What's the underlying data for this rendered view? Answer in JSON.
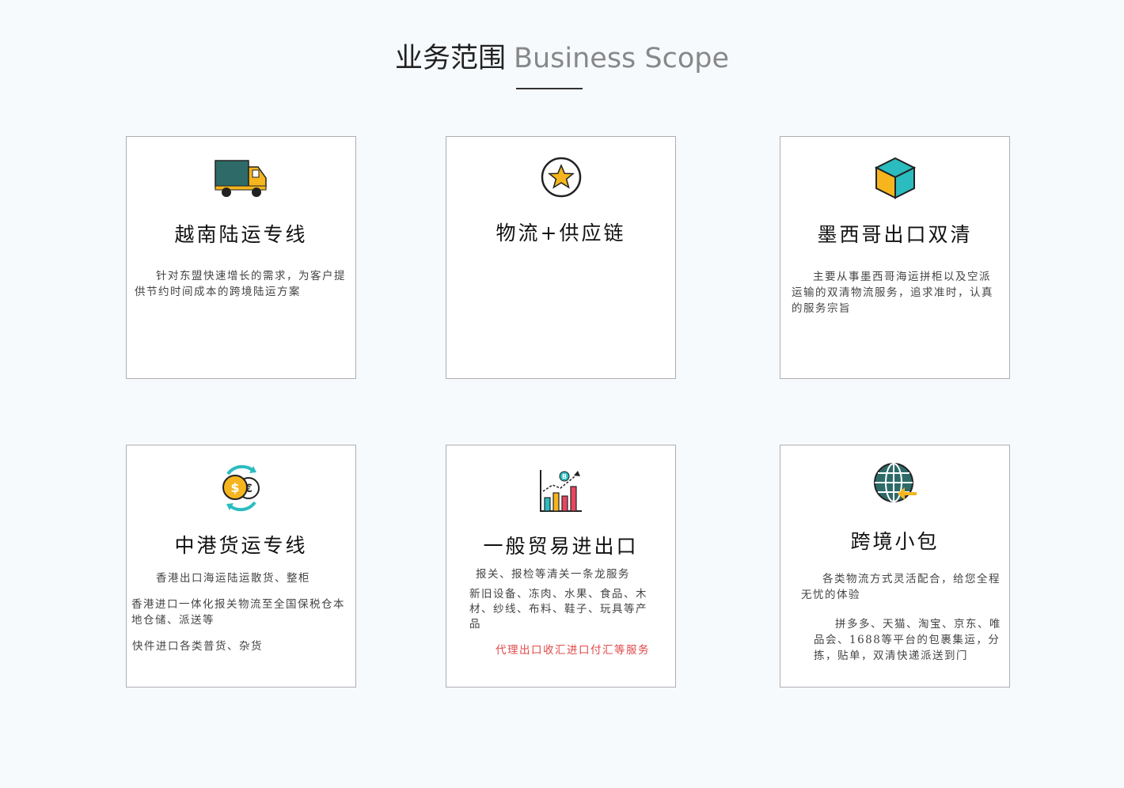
{
  "header": {
    "title_cn": "业务范围",
    "title_en": "Business Scope"
  },
  "colors": {
    "accent_yellow": "#f6b51d",
    "accent_teal": "#2bbcc0",
    "dark_teal": "#2e6b68",
    "red_text": "#e04848"
  },
  "cards": [
    {
      "icon": "truck-icon",
      "title": "越南陆运专线",
      "lines": [
        "针对东盟快速增长的需求，为客户提供节约时间成本的跨境陆运方案"
      ]
    },
    {
      "icon": "star-badge-icon",
      "title": "物流+供应链",
      "lines": []
    },
    {
      "icon": "cube-icon",
      "title": "墨西哥出口双清",
      "lines": [
        "主要从事墨西哥海运拼柜以及空派运输的双清物流服务，追求准时，认真的服务宗旨"
      ]
    },
    {
      "icon": "currency-exchange-icon",
      "title": "中港货运专线",
      "lines": [
        "香港出口海运陆运散货、整柜",
        "香港进口一体化报关物流至全国保税仓本地仓储、派送等",
        "快件进口各类普货、杂货"
      ]
    },
    {
      "icon": "bar-chart-growth-icon",
      "title": "一般贸易进出口",
      "lines": [
        "报关、报检等清关一条龙服务",
        "新旧设备、冻肉、水果、食品、木材、纱线、布料、鞋子、玩具等产品",
        "代理出口收汇进口付汇等服务"
      ]
    },
    {
      "icon": "globe-arrow-icon",
      "title": "跨境小包",
      "lines": [
        "各类物流方式灵活配合，给您全程无忧的体验",
        "拼多多、天猫、淘宝、京东、唯品会、1688等平台的包裹集运，分拣，贴单，双清快递派送到门"
      ]
    }
  ]
}
